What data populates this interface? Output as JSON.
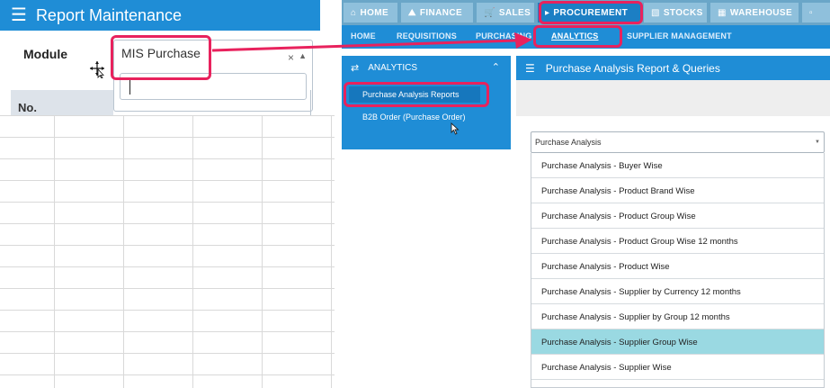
{
  "left": {
    "header_title": "Report Maintenance",
    "module_label": "Module",
    "module_select_value": "MIS Purchase",
    "clear_symbol": "×",
    "caret_symbol": "▲",
    "table_first_header": "No."
  },
  "topnav": {
    "tabs": [
      {
        "label": "HOME",
        "icon": "home-icon"
      },
      {
        "label": "FINANCE",
        "icon": "bank-icon"
      },
      {
        "label": "SALES",
        "icon": "cart-icon"
      },
      {
        "label": "PROCUREMENT",
        "icon": "megaphone-icon"
      },
      {
        "label": "STOCKS",
        "icon": "bar-chart-icon"
      },
      {
        "label": "WAREHOUSE",
        "icon": "warehouse-icon"
      }
    ],
    "active": "PROCUREMENT"
  },
  "subnav": {
    "items": [
      "HOME",
      "REQUISITIONS",
      "PURCHASING",
      "ANALYTICS",
      "SUPPLIER MANAGEMENT"
    ],
    "active": "ANALYTICS"
  },
  "sidebar": {
    "header": "ANALYTICS",
    "items": [
      "Purchase Analysis Reports",
      "B2B Order (Purchase Order)"
    ],
    "active": "Purchase Analysis Reports"
  },
  "main": {
    "title": "Purchase Analysis Report & Queries",
    "dropdown_value": "Purchase Analysis",
    "options": [
      "Purchase Analysis - Buyer Wise",
      "Purchase Analysis - Product Brand Wise",
      "Purchase Analysis - Product Group Wise",
      "Purchase Analysis - Product Group Wise 12 months",
      "Purchase Analysis - Product Wise",
      "Purchase Analysis - Supplier by Currency 12 months",
      "Purchase Analysis - Supplier by Group 12 months",
      "Purchase Analysis - Supplier Group Wise",
      "Purchase Analysis - Supplier Wise"
    ],
    "selected_option": "Purchase Analysis - Supplier Group Wise"
  },
  "colors": {
    "accent_blue": "#1f8dd6",
    "highlight": "#e8225d",
    "selected_option": "#9ad9e2"
  }
}
